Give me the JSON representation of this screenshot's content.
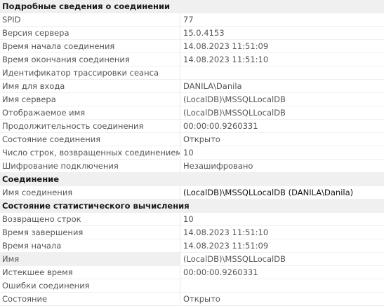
{
  "sections": [
    {
      "title": "Подробные сведения о соединении",
      "rows": [
        {
          "name": "SPID",
          "value": "77"
        },
        {
          "name": "Версия сервера",
          "value": "15.0.4153"
        },
        {
          "name": "Время начала соединения",
          "value": "14.08.2023 11:51:09"
        },
        {
          "name": "Время окончания соединения",
          "value": "14.08.2023 11:51:10"
        },
        {
          "name": "Идентификатор трассировки сеанса",
          "value": ""
        },
        {
          "name": "Имя для входа",
          "value": "DANILA\\Danila"
        },
        {
          "name": "Имя сервера",
          "value": "(LocalDB)\\MSSQLLocalDB"
        },
        {
          "name": "Отображаемое имя",
          "value": "(LocalDB)\\MSSQLLocalDB"
        },
        {
          "name": "Продолжительность соединения",
          "value": "00:00:00.9260331"
        },
        {
          "name": "Состояние соединения",
          "value": "Открыто"
        },
        {
          "name": "Число строк, возвращенных соединением",
          "value": "10"
        },
        {
          "name": "Шифрование подключения",
          "value": "Незашифровано"
        }
      ]
    },
    {
      "title": "Соединение",
      "rows": [
        {
          "name": "Имя соединения",
          "value": "(LocalDB)\\MSSQLLocalDB (DANILA\\Danila)"
        }
      ]
    },
    {
      "title": "Состояние статистического вычисления",
      "rows": [
        {
          "name": "Возвращено строк",
          "value": "10"
        },
        {
          "name": "Время завершения",
          "value": "14.08.2023 11:51:10"
        },
        {
          "name": "Время начала",
          "value": "14.08.2023 11:51:09"
        },
        {
          "name": "Имя",
          "value": "(LocalDB)\\MSSQLLocalDB"
        },
        {
          "name": "Истекшее время",
          "value": "00:00:00.9260331"
        },
        {
          "name": "Ошибки соединения",
          "value": ""
        },
        {
          "name": "Состояние",
          "value": "Открыто"
        }
      ]
    }
  ]
}
